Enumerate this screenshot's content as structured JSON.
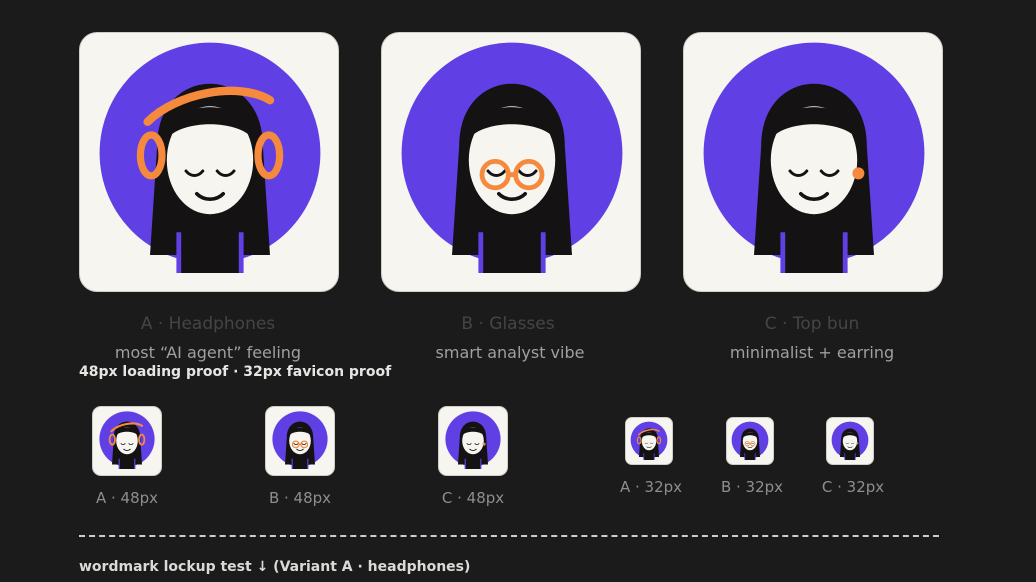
{
  "colors": {
    "background": "#1c1b1c",
    "card": "#f6f5f0",
    "circle": "#6040e4",
    "hair": "#151214",
    "face": "#f6f5f0",
    "accent_orange": "#f58a3d"
  },
  "variants": [
    {
      "id": "A",
      "title": "A · Headphones",
      "caption": "most “AI agent” feeling",
      "accessory": "headphones-icon"
    },
    {
      "id": "B",
      "title": "B · Glasses",
      "caption": "smart analyst vibe",
      "accessory": "glasses-icon"
    },
    {
      "id": "C",
      "title": "C · Top bun",
      "caption": "minimalist + earring",
      "accessory": "earring-icon"
    }
  ],
  "proof_heading": "48px loading proof · 32px favicon proof",
  "proofs_48": [
    {
      "label": "A · 48px"
    },
    {
      "label": "B · 48px"
    },
    {
      "label": "C · 48px"
    }
  ],
  "proofs_32": [
    {
      "label": "A · 32px"
    },
    {
      "label": "B · 32px"
    },
    {
      "label": "C · 32px"
    }
  ],
  "wordmark_heading": "wordmark lockup test ↓ (Variant A · headphones)"
}
